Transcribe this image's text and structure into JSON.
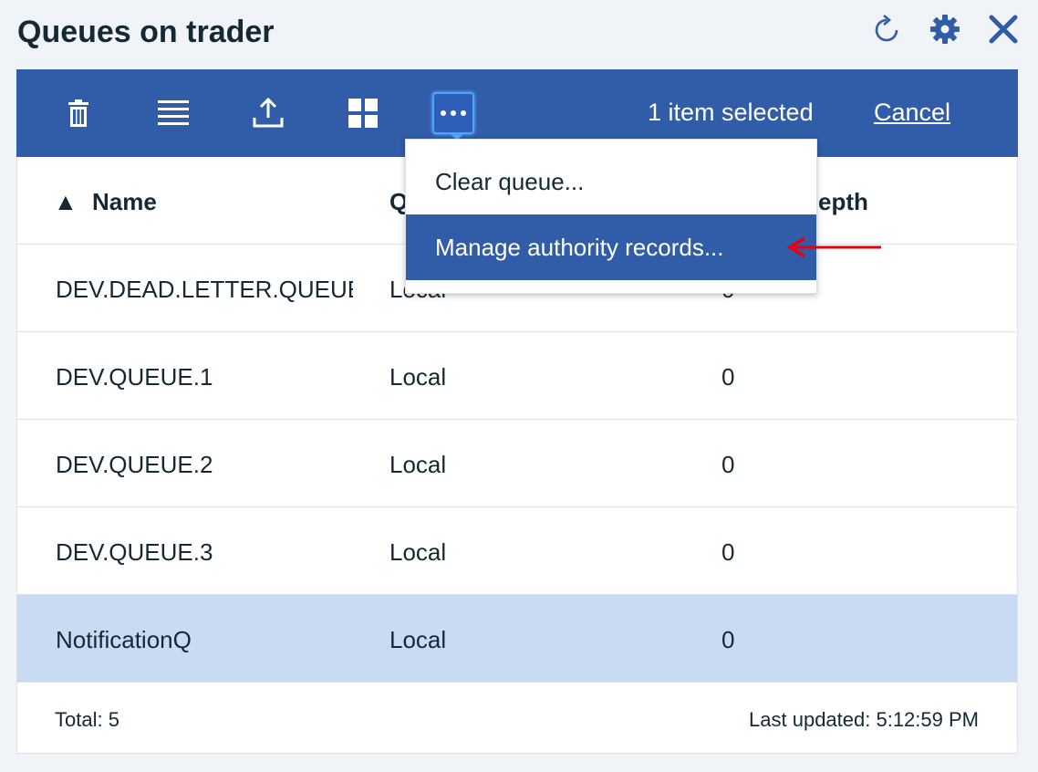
{
  "header": {
    "title": "Queues on trader"
  },
  "header_icons": [
    "refresh-icon",
    "gear-icon",
    "close-icon"
  ],
  "toolbar": {
    "buttons": [
      "trash-icon",
      "list-view-icon",
      "upload-icon",
      "grid-view-icon",
      "more-options-icon"
    ],
    "selection_text": "1 item selected",
    "cancel_label": "Cancel"
  },
  "menu": {
    "items": [
      "Clear queue...",
      "Manage authority records..."
    ],
    "highlighted_index": 1
  },
  "table": {
    "columns": [
      {
        "sort_indicator": "▲",
        "label": "Name"
      },
      {
        "label": "Q"
      },
      {
        "label": "epth"
      }
    ],
    "rows": [
      {
        "name": "DEV.DEAD.LETTER.QUEUE",
        "type": "Local",
        "depth": "0"
      },
      {
        "name": "DEV.QUEUE.1",
        "type": "Local",
        "depth": "0"
      },
      {
        "name": "DEV.QUEUE.2",
        "type": "Local",
        "depth": "0"
      },
      {
        "name": "DEV.QUEUE.3",
        "type": "Local",
        "depth": "0"
      },
      {
        "name": "NotificationQ",
        "type": "Local",
        "depth": "0"
      }
    ],
    "selected_row_index": 4
  },
  "footer": {
    "total": "Total: 5",
    "last_updated": "Last updated: 5:12:59 PM"
  },
  "colors": {
    "toolbar_bg": "#305ca8",
    "selected_row_bg": "#c9dbf2",
    "icon_blue": "#305ca8",
    "annotation_arrow": "#e60012"
  }
}
